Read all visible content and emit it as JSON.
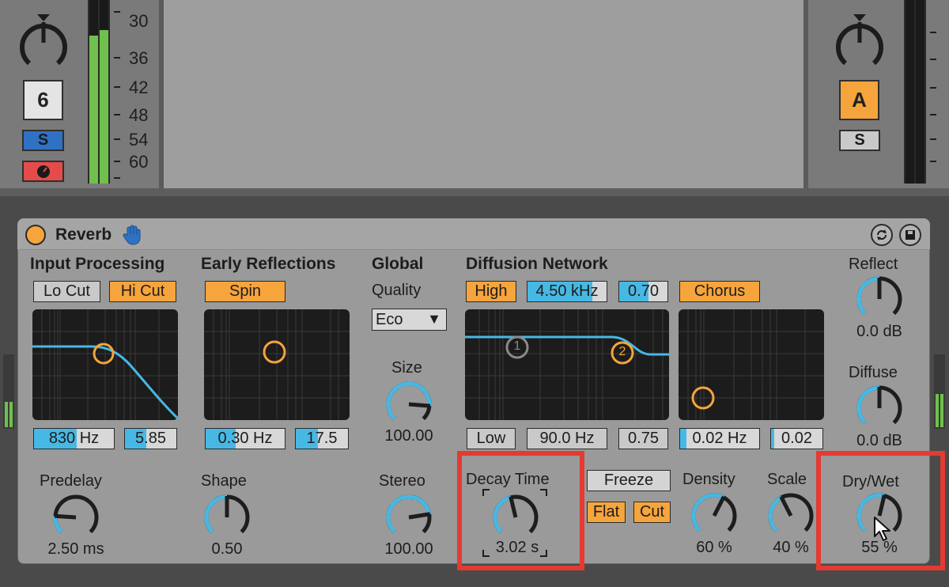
{
  "mixer": {
    "left_track": {
      "number": "6",
      "solo": "S",
      "rec_icon": "metronome-icon"
    },
    "db_scale": [
      "30",
      "36",
      "42",
      "48",
      "54",
      "60"
    ],
    "right_track": {
      "name": "A",
      "solo": "S"
    }
  },
  "device": {
    "title": "Reverb",
    "sections": {
      "input": "Input Processing",
      "early": "Early Reflections",
      "global": "Global",
      "diffusion": "Diffusion Network"
    },
    "input": {
      "lo_cut": "Lo Cut",
      "hi_cut": "Hi Cut",
      "freq": "830 Hz",
      "freq_fill": 0.53,
      "q": "5.85",
      "q_fill": 0.42
    },
    "early": {
      "spin": "Spin",
      "amount": "0.30 Hz",
      "amount_fill": 0.38,
      "rate": "17.5",
      "rate_fill": 0.42
    },
    "global": {
      "quality_label": "Quality",
      "quality": "Eco",
      "size_label": "Size",
      "size_value": "100.00",
      "size_level": 0.85,
      "stereo_label": "Stereo",
      "stereo_value": "100.00",
      "stereo_level": 0.8
    },
    "diffusion": {
      "high": "High",
      "high_freq": "4.50 kHz",
      "high_freq_fill": 0.82,
      "high_q": "0.70",
      "high_q_fill": 0.6,
      "chorus": "Chorus",
      "low": "Low",
      "low_freq": "90.0 Hz",
      "low_q": "0.75",
      "chorus_rate": "0.02 Hz",
      "chorus_rate_fill": 0.08,
      "chorus_amount": "0.02",
      "chorus_amount_fill": 0.06,
      "node1": "1",
      "node2": "2"
    },
    "predelay": {
      "label": "Predelay",
      "value": "2.50 ms",
      "level": 0.18
    },
    "shape": {
      "label": "Shape",
      "value": "0.50",
      "level": 0.5
    },
    "decay": {
      "label": "Decay Time",
      "value": "3.02 s",
      "level": 0.45
    },
    "freeze": {
      "label": "Freeze",
      "flat": "Flat",
      "cut": "Cut"
    },
    "density": {
      "label": "Density",
      "value": "60 %",
      "level": 0.6
    },
    "scale": {
      "label": "Scale",
      "value": "40 %",
      "level": 0.4
    },
    "reflect": {
      "label": "Reflect",
      "value": "0.0 dB",
      "level": 0.5
    },
    "diffuse": {
      "label": "Diffuse",
      "value": "0.0 dB",
      "level": 0.5
    },
    "drywet": {
      "label": "Dry/Wet",
      "value": "55 %",
      "level": 0.55
    }
  },
  "colors": {
    "accent_blue": "#47b8e3",
    "accent_orange": "#f6a43c",
    "highlight_red": "#e33a32",
    "meter_green": "#6fc04c"
  }
}
